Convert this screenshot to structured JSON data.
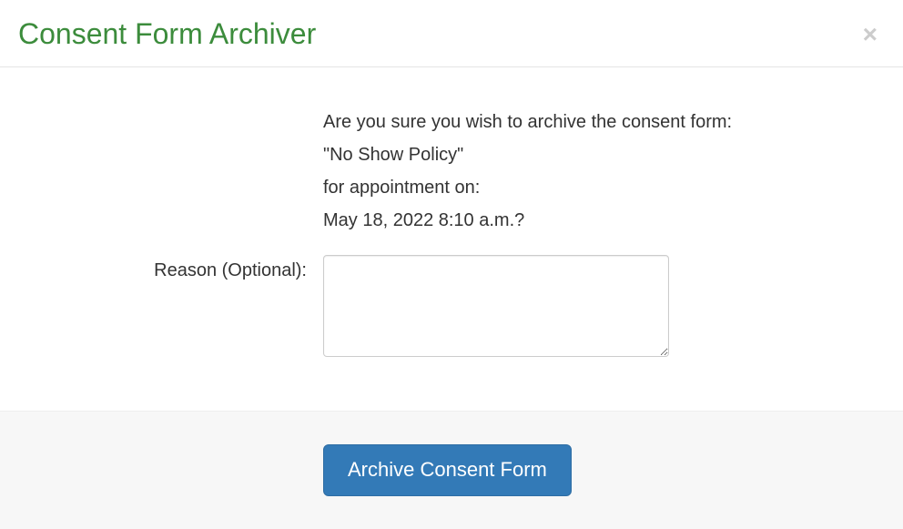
{
  "header": {
    "title": "Consent Form Archiver"
  },
  "body": {
    "confirm_line1": "Are you sure you wish to archive the consent form:",
    "form_name": "\"No Show Policy\"",
    "confirm_line2": "for appointment on:",
    "appointment_datetime": "May 18, 2022 8:10 a.m.?",
    "reason_label": "Reason (Optional):",
    "reason_value": ""
  },
  "footer": {
    "archive_button_label": "Archive Consent Form"
  }
}
